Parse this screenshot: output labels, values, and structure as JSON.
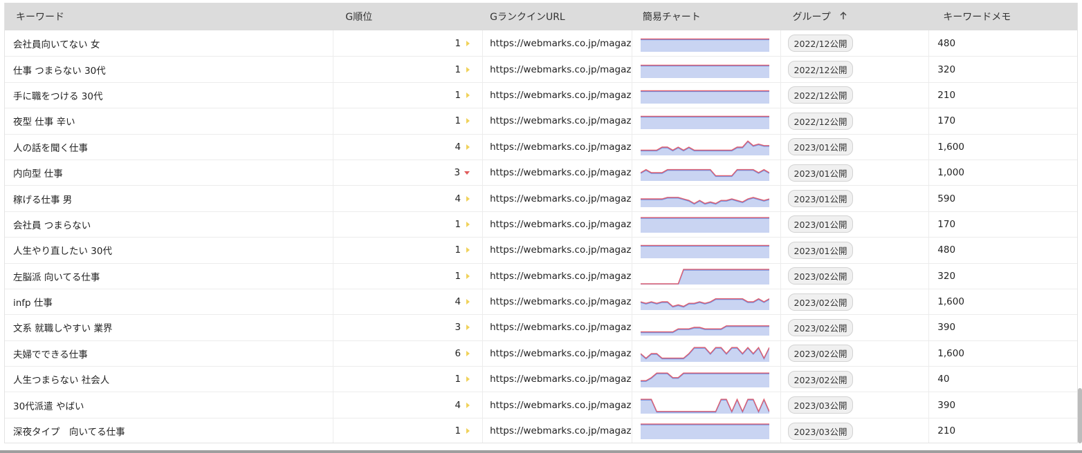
{
  "header": {
    "keyword": "キーワード",
    "rank": "G順位",
    "url": "GランクインURL",
    "chart": "簡易チャート",
    "group": "グループ",
    "sort_icon": "arrow-up-icon",
    "memo": "キーワードメモ"
  },
  "colors": {
    "google_line": "#e06070",
    "alt_line": "#6f8ee0",
    "fill": "#c9d4f2",
    "up_arrow": "#f0d25a",
    "down_arrow": "#e05a5a"
  },
  "rows": [
    {
      "keyword": "会社員向いてない 女",
      "rank": "1",
      "trend": "flat",
      "url": "https://webmarks.co.jp/magazin",
      "group": "2022/12公開",
      "memo": "480",
      "chart": [
        0.8,
        0.8,
        0.8,
        0.8,
        0.8,
        0.8,
        0.8,
        0.8,
        0.8,
        0.8,
        0.8,
        0.8,
        0.8,
        0.8,
        0.8,
        0.8,
        0.8,
        0.8,
        0.8,
        0.8,
        0.8,
        0.8,
        0.8,
        0.8,
        0.8
      ]
    },
    {
      "keyword": "仕事 つまらない 30代",
      "rank": "1",
      "trend": "flat",
      "url": "https://webmarks.co.jp/magazin",
      "group": "2022/12公開",
      "memo": "320",
      "chart": [
        0.8,
        0.8,
        0.8,
        0.8,
        0.8,
        0.8,
        0.8,
        0.8,
        0.8,
        0.8,
        0.8,
        0.8,
        0.8,
        0.8,
        0.8,
        0.8,
        0.8,
        0.8,
        0.8,
        0.8,
        0.8,
        0.8,
        0.8,
        0.8,
        0.8
      ]
    },
    {
      "keyword": "手に職をつける 30代",
      "rank": "1",
      "trend": "flat",
      "url": "https://webmarks.co.jp/magazin",
      "group": "2022/12公開",
      "memo": "210",
      "chart": [
        0.8,
        0.8,
        0.8,
        0.8,
        0.8,
        0.8,
        0.8,
        0.8,
        0.8,
        0.8,
        0.8,
        0.8,
        0.8,
        0.8,
        0.8,
        0.8,
        0.8,
        0.8,
        0.8,
        0.8,
        0.8,
        0.8,
        0.8,
        0.8,
        0.8
      ]
    },
    {
      "keyword": "夜型 仕事 辛い",
      "rank": "1",
      "trend": "flat",
      "url": "https://webmarks.co.jp/magazin",
      "group": "2022/12公開",
      "memo": "170",
      "chart": [
        0.8,
        0.8,
        0.8,
        0.8,
        0.8,
        0.8,
        0.8,
        0.8,
        0.8,
        0.8,
        0.8,
        0.8,
        0.8,
        0.8,
        0.8,
        0.8,
        0.8,
        0.8,
        0.8,
        0.8,
        0.8,
        0.8,
        0.8,
        0.8,
        0.8
      ]
    },
    {
      "keyword": "人の話を聞く仕事",
      "rank": "4",
      "trend": "flat",
      "url": "https://webmarks.co.jp/magazin",
      "group": "2023/01公開",
      "memo": "1,600",
      "chart": [
        0.3,
        0.3,
        0.3,
        0.3,
        0.5,
        0.5,
        0.3,
        0.5,
        0.3,
        0.5,
        0.3,
        0.3,
        0.3,
        0.3,
        0.3,
        0.3,
        0.3,
        0.3,
        0.5,
        0.5,
        0.9,
        0.6,
        0.7,
        0.6,
        0.6
      ]
    },
    {
      "keyword": "内向型 仕事",
      "rank": "3",
      "trend": "down",
      "url": "https://webmarks.co.jp/magazin",
      "group": "2023/01公開",
      "memo": "1,000",
      "chart": [
        0.5,
        0.7,
        0.5,
        0.5,
        0.5,
        0.7,
        0.7,
        0.7,
        0.7,
        0.7,
        0.7,
        0.7,
        0.7,
        0.7,
        0.3,
        0.3,
        0.3,
        0.3,
        0.7,
        0.7,
        0.7,
        0.7,
        0.5,
        0.7,
        0.5
      ]
    },
    {
      "keyword": "稼げる仕事 男",
      "rank": "4",
      "trend": "flat",
      "url": "https://webmarks.co.jp/magazin",
      "group": "2023/01公開",
      "memo": "590",
      "chart": [
        0.5,
        0.5,
        0.5,
        0.5,
        0.5,
        0.6,
        0.6,
        0.6,
        0.5,
        0.4,
        0.2,
        0.4,
        0.2,
        0.3,
        0.2,
        0.4,
        0.4,
        0.5,
        0.4,
        0.3,
        0.5,
        0.6,
        0.5,
        0.4,
        0.5
      ]
    },
    {
      "keyword": "会社員 つまらない",
      "rank": "1",
      "trend": "flat",
      "url": "https://webmarks.co.jp/magazin",
      "group": "2023/01公開",
      "memo": "170",
      "chart": [
        0.95,
        0.95,
        0.95,
        0.95,
        0.95,
        0.95,
        0.95,
        0.95,
        0.95,
        0.95,
        0.95,
        0.95,
        0.95,
        0.95,
        0.95,
        0.95,
        0.95,
        0.95,
        0.95,
        0.95,
        0.95,
        0.95,
        0.95,
        0.95,
        0.95
      ]
    },
    {
      "keyword": "人生やり直したい 30代",
      "rank": "1",
      "trend": "flat",
      "url": "https://webmarks.co.jp/magazin",
      "group": "2023/01公開",
      "memo": "480",
      "chart": [
        0.8,
        0.8,
        0.8,
        0.8,
        0.8,
        0.8,
        0.8,
        0.8,
        0.8,
        0.8,
        0.8,
        0.8,
        0.8,
        0.8,
        0.8,
        0.8,
        0.8,
        0.8,
        0.8,
        0.8,
        0.8,
        0.8,
        0.8,
        0.8,
        0.8
      ]
    },
    {
      "keyword": "左脳派 向いてる仕事",
      "rank": "1",
      "trend": "flat",
      "url": "https://webmarks.co.jp/magazin",
      "group": "2023/02公開",
      "memo": "320",
      "chart": [
        0,
        0,
        0,
        0,
        0,
        0,
        0,
        0,
        0.95,
        0.95,
        0.95,
        0.95,
        0.95,
        0.95,
        0.95,
        0.95,
        0.95,
        0.95,
        0.95,
        0.95,
        0.95,
        0.95,
        0.95,
        0.95,
        0.95
      ]
    },
    {
      "keyword": "infp 仕事",
      "rank": "4",
      "trend": "flat",
      "url": "https://webmarks.co.jp/magazin",
      "group": "2023/02公開",
      "memo": "1,600",
      "chart": [
        0.5,
        0.4,
        0.5,
        0.4,
        0.5,
        0.5,
        0.2,
        0.3,
        0.2,
        0.4,
        0.4,
        0.5,
        0.4,
        0.5,
        0.7,
        0.7,
        0.7,
        0.7,
        0.7,
        0.7,
        0.5,
        0.5,
        0.7,
        0.5,
        0.7
      ]
    },
    {
      "keyword": "文系 就職しやすい 業界",
      "rank": "3",
      "trend": "flat",
      "url": "https://webmarks.co.jp/magazin",
      "group": "2023/02公開",
      "memo": "390",
      "chart": [
        0.2,
        0.2,
        0.2,
        0.2,
        0.2,
        0.2,
        0.2,
        0.4,
        0.4,
        0.4,
        0.5,
        0.5,
        0.4,
        0.4,
        0.4,
        0.4,
        0.6,
        0.6,
        0.6,
        0.6,
        0.6,
        0.6,
        0.6,
        0.6,
        0.6
      ]
    },
    {
      "keyword": "夫婦でできる仕事",
      "rank": "6",
      "trend": "flat",
      "url": "https://webmarks.co.jp/magazin",
      "group": "2023/02公開",
      "memo": "1,600",
      "chart": [
        0.5,
        0.2,
        0.5,
        0.5,
        0.2,
        0.2,
        0.2,
        0.2,
        0.2,
        0.5,
        0.9,
        0.9,
        0.9,
        0.5,
        0.9,
        0.9,
        0.5,
        0.9,
        0.9,
        0.5,
        0.9,
        0.5,
        0.9,
        0.2,
        0.9
      ]
    },
    {
      "keyword": "人生つまらない 社会人",
      "rank": "1",
      "trend": "flat",
      "url": "https://webmarks.co.jp/magazin",
      "group": "2023/02公開",
      "memo": "40",
      "chart": [
        0.4,
        0.4,
        0.6,
        0.9,
        0.9,
        0.9,
        0.6,
        0.6,
        0.9,
        0.9,
        0.9,
        0.9,
        0.9,
        0.9,
        0.9,
        0.9,
        0.9,
        0.9,
        0.9,
        0.9,
        0.9,
        0.9,
        0.9,
        0.9,
        0.9
      ]
    },
    {
      "keyword": "30代派遣 やばい",
      "rank": "4",
      "trend": "flat",
      "url": "https://webmarks.co.jp/magazin",
      "group": "2023/03公開",
      "memo": "390",
      "chart": [
        0.9,
        0.9,
        0.9,
        0.1,
        0.1,
        0.1,
        0.1,
        0.1,
        0.1,
        0.1,
        0.1,
        0.1,
        0.1,
        0.1,
        0.1,
        0.9,
        0.9,
        0.1,
        0.9,
        0.1,
        0.9,
        0.9,
        0.1,
        0.9,
        0.1
      ]
    },
    {
      "keyword": "深夜タイプ　向いてる仕事",
      "rank": "1",
      "trend": "flat",
      "url": "https://webmarks.co.jp/magazin",
      "group": "2023/03公開",
      "memo": "210",
      "chart": [
        0.95,
        0.95,
        0.95,
        0.95,
        0.95,
        0.95,
        0.95,
        0.95,
        0.95,
        0.95,
        0.95,
        0.95,
        0.95,
        0.95,
        0.95,
        0.95,
        0.95,
        0.95,
        0.95,
        0.95,
        0.95,
        0.95,
        0.95,
        0.95,
        0.95
      ]
    }
  ]
}
